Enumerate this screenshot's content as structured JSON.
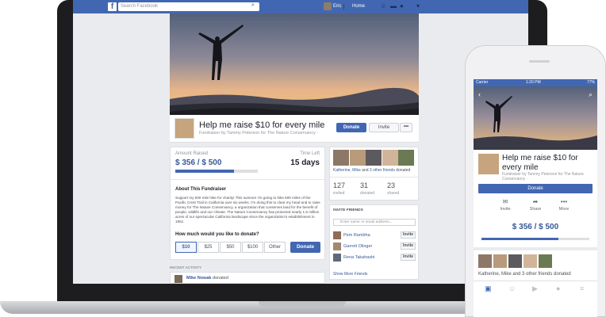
{
  "facebook_bar": {
    "logo": "f",
    "search_placeholder": "Search Facebook",
    "user_name": "Eric",
    "home_label": "Home",
    "icons": [
      "friends-icon",
      "messages-icon",
      "globe-icon",
      "lock-icon"
    ]
  },
  "fundraiser": {
    "title": "Help me raise $10 for every mile",
    "subtitle": "Fundraiser by Tammy Peterson for The Nature Conservancy · ",
    "donate_label": "Donate",
    "invite_label": "Invite",
    "more_label": "•••",
    "amount_raised_label": "Amount Raised",
    "amount_raised": "$ 356 / $ 500",
    "progress_fraction": 0.712,
    "time_left_label": "Time Left",
    "time_left": "15 days",
    "about_title": "About This Fundraiser",
    "about_body": "Support my 500 mile hike for charity! This summer I'm going to hike 500 miles of the Pacific Crest Trail in California over six weeks. I'm doing this to clear my head and to raise money for The Nature Conservancy, a organization that conserves land for the benefit of people, wildlife and our climate. The Nature Conservancy has protected nearly 1.5 million acres of our spectacular California landscape since the organization's establishment in 1951.",
    "how_much_label": "How much would you like to donate?",
    "amounts": [
      "$10",
      "$25",
      "$50",
      "$100",
      "Other"
    ],
    "selected_amount": "$10",
    "donate_big_label": "Donate"
  },
  "recent_activity": {
    "title": "RECENT ACTIVITY",
    "entries": [
      {
        "name": "Mike Nowak",
        "action": "donated"
      }
    ]
  },
  "friends_summary": {
    "text_prefix": "Katherine, Mike",
    "text_and": " and ",
    "text_others": "3 other friends",
    "text_suffix": " donated",
    "stats": [
      {
        "value": "127",
        "label": "invited"
      },
      {
        "value": "31",
        "label": "donated"
      },
      {
        "value": "23",
        "label": "shared"
      }
    ]
  },
  "invite_friends": {
    "title": "INVITE FRIENDS",
    "input_placeholder": "Enter name or email address...",
    "friends": [
      {
        "name": "Pem Rambha",
        "button": "Invite"
      },
      {
        "name": "Garrett Olinger",
        "button": "Invite"
      },
      {
        "name": "Rena Takahashi",
        "button": "Invite"
      }
    ],
    "show_more": "Show More Friends"
  },
  "phone": {
    "carrier": "Carrier",
    "time": "1:20 PM",
    "battery": "77%",
    "title": "Help me raise $10 for every mile",
    "subtitle": "Fundraiser by Tammy Peterson for The Nature Conservancy · ",
    "donate_label": "Donate",
    "actions": [
      {
        "icon": "invite-icon",
        "label": "Invite"
      },
      {
        "icon": "share-icon",
        "label": "Share"
      },
      {
        "icon": "more-icon",
        "label": "More"
      }
    ],
    "amount": "$ 356 / $ 500",
    "friends_text": "Katherine, Mike and 3 other friends donated"
  },
  "colors": {
    "fb_blue": "#4267b2",
    "link_blue": "#365899",
    "page_bg": "#e9ebee"
  }
}
